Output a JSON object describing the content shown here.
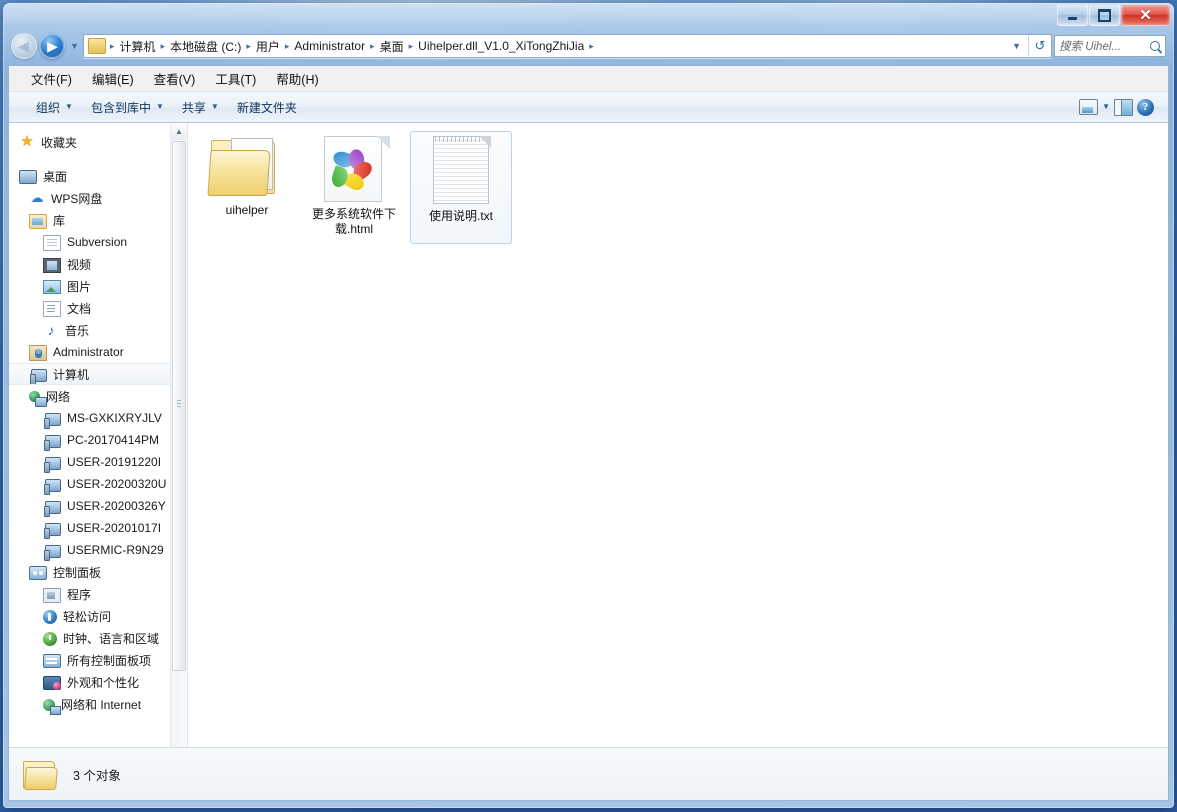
{
  "window": {
    "caption_buttons": {
      "minimize": "—",
      "maximize": "□",
      "close": "✕"
    }
  },
  "nav": {
    "back_arrow": "◀",
    "forward_arrow": "▶",
    "history_caret": "▼",
    "refresh_glyph": "↺"
  },
  "address": {
    "separator": "▸",
    "dropdown_caret": "▼",
    "crumbs": [
      "计算机",
      "本地磁盘 (C:)",
      "用户",
      "Administrator",
      "桌面",
      "Uihelper.dll_V1.0_XiTongZhiJia"
    ]
  },
  "search": {
    "placeholder": "搜索 Uihel..."
  },
  "menubar": {
    "items": [
      "文件(F)",
      "编辑(E)",
      "查看(V)",
      "工具(T)",
      "帮助(H)"
    ]
  },
  "commandbar": {
    "caret": "▼",
    "items": [
      {
        "label": "组织",
        "has_caret": true
      },
      {
        "label": "包含到库中",
        "has_caret": true
      },
      {
        "label": "共享",
        "has_caret": true
      },
      {
        "label": "新建文件夹",
        "has_caret": false
      }
    ],
    "help_glyph": "?"
  },
  "sidebar": {
    "nodes": [
      {
        "label": "收藏夹",
        "icon": "favorites-star-icon",
        "level": 0,
        "selected": false,
        "gap": false
      },
      {
        "label": "桌面",
        "icon": "desktop-monitor-icon",
        "level": 0,
        "selected": false,
        "gap": true
      },
      {
        "label": "WPS网盘",
        "icon": "cloud-icon",
        "level": 1,
        "selected": false,
        "gap": false
      },
      {
        "label": "库",
        "icon": "library-folder-icon",
        "level": 1,
        "selected": false,
        "gap": false
      },
      {
        "label": "Subversion",
        "icon": "subversion-doc-icon",
        "level": 2,
        "selected": false,
        "gap": false
      },
      {
        "label": "视频",
        "icon": "video-library-icon",
        "level": 2,
        "selected": false,
        "gap": false
      },
      {
        "label": "图片",
        "icon": "pictures-library-icon",
        "level": 2,
        "selected": false,
        "gap": false
      },
      {
        "label": "文档",
        "icon": "documents-library-icon",
        "level": 2,
        "selected": false,
        "gap": false
      },
      {
        "label": "音乐",
        "icon": "music-library-icon",
        "level": 2,
        "selected": false,
        "gap": false
      },
      {
        "label": "Administrator",
        "icon": "user-folder-icon",
        "level": 1,
        "selected": false,
        "gap": false
      },
      {
        "label": "计算机",
        "icon": "computer-icon",
        "level": 1,
        "selected": true,
        "gap": false
      },
      {
        "label": "网络",
        "icon": "network-icon",
        "level": 1,
        "selected": false,
        "gap": false
      },
      {
        "label": "MS-GXKIXRYJLV",
        "icon": "network-computer-icon",
        "level": 2,
        "selected": false,
        "gap": false
      },
      {
        "label": "PC-20170414PM",
        "icon": "network-computer-icon",
        "level": 2,
        "selected": false,
        "gap": false
      },
      {
        "label": "USER-20191220I",
        "icon": "network-computer-icon",
        "level": 2,
        "selected": false,
        "gap": false
      },
      {
        "label": "USER-20200320U",
        "icon": "network-computer-icon",
        "level": 2,
        "selected": false,
        "gap": false
      },
      {
        "label": "USER-20200326Y",
        "icon": "network-computer-icon",
        "level": 2,
        "selected": false,
        "gap": false
      },
      {
        "label": "USER-20201017I",
        "icon": "network-computer-icon",
        "level": 2,
        "selected": false,
        "gap": false
      },
      {
        "label": "USERMIC-R9N29",
        "icon": "network-computer-icon",
        "level": 2,
        "selected": false,
        "gap": false
      },
      {
        "label": "控制面板",
        "icon": "control-panel-icon",
        "level": 1,
        "selected": false,
        "gap": false
      },
      {
        "label": "程序",
        "icon": "programs-icon",
        "level": 2,
        "selected": false,
        "gap": false
      },
      {
        "label": "轻松访问",
        "icon": "ease-of-access-icon",
        "level": 2,
        "selected": false,
        "gap": false
      },
      {
        "label": "时钟、语言和区域",
        "icon": "clock-language-region-icon",
        "level": 2,
        "selected": false,
        "gap": false
      },
      {
        "label": "所有控制面板项",
        "icon": "all-control-panel-items-icon",
        "level": 2,
        "selected": false,
        "gap": false
      },
      {
        "label": "外观和个性化",
        "icon": "appearance-personalization-icon",
        "level": 2,
        "selected": false,
        "gap": false
      },
      {
        "label": "网络和 Internet",
        "icon": "network-internet-icon",
        "level": 2,
        "selected": false,
        "gap": false
      }
    ],
    "scroll_up_arrow": "▲",
    "scroll_down_arrow": "▼"
  },
  "files": {
    "items": [
      {
        "name": "uihelper",
        "type": "folder",
        "selected": false
      },
      {
        "name": "更多系统软件下载.html",
        "type": "html",
        "selected": false
      },
      {
        "name": "使用说明.txt",
        "type": "txt",
        "selected": true
      }
    ]
  },
  "statusbar": {
    "text": "3 个对象"
  }
}
